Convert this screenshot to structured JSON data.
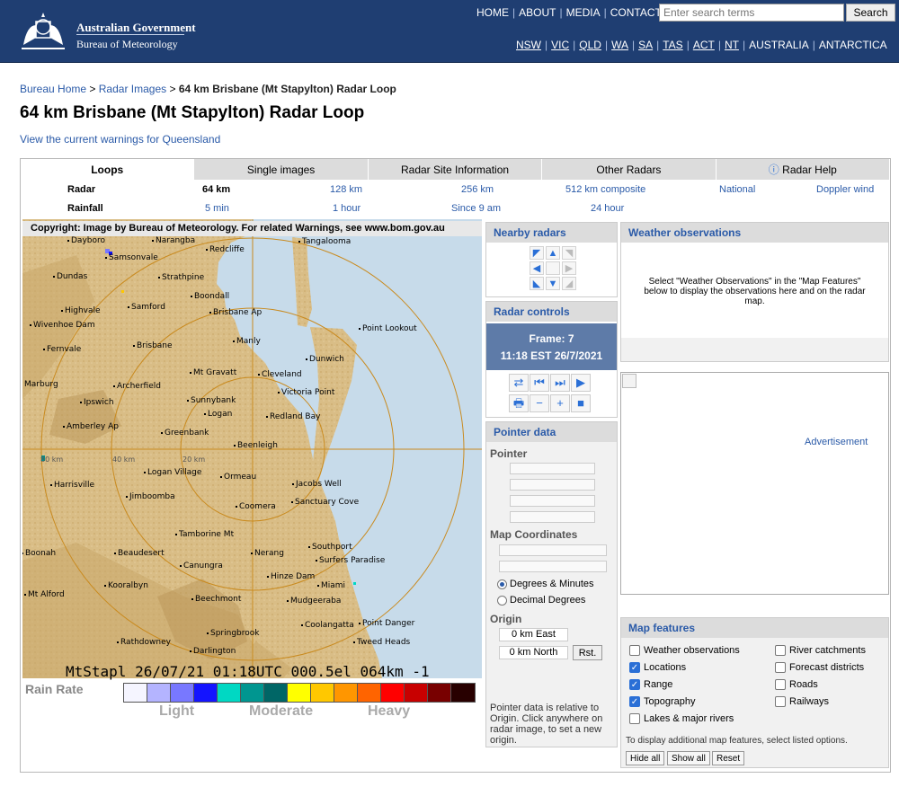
{
  "header": {
    "gov_name": "Australian Government",
    "agency_name": "Bureau of Meteorology",
    "top_links": [
      "HOME",
      "ABOUT",
      "MEDIA",
      "CONTACTS"
    ],
    "search_placeholder": "Enter search terms",
    "search_button": "Search",
    "state_links": [
      "NSW",
      "VIC",
      "QLD",
      "WA",
      "SA",
      "TAS",
      "ACT",
      "NT",
      "AUSTRALIA",
      "ANTARCTICA"
    ]
  },
  "breadcrumb": {
    "home": "Bureau Home",
    "sep": ">",
    "images": "Radar Images",
    "current": "64 km Brisbane (Mt Stapylton) Radar Loop"
  },
  "page_title": "64 km Brisbane (Mt Stapylton) Radar Loop",
  "warnings_link": "View the current warnings for Queensland",
  "tabs": [
    "Loops",
    "Single images",
    "Radar Site Information",
    "Other Radars",
    "Radar Help"
  ],
  "tab_help_icon": "info-icon",
  "radar_row": {
    "label": "Radar",
    "options": [
      "64 km",
      "128 km",
      "256 km",
      "512 km composite",
      "National",
      "Doppler wind"
    ]
  },
  "rain_row": {
    "label": "Rainfall",
    "options": [
      "5 min",
      "1 hour",
      "Since 9 am",
      "24 hour"
    ]
  },
  "radar_image": {
    "copyright": "Copyright: Image by Bureau of Meteorology. For related Warnings, see www.bom.gov.au",
    "caption": "MtStapl 26/07/21 01:18UTC 000.5el 064km -1",
    "range_labels": [
      "80 km",
      "40 km",
      "20 km"
    ],
    "places": [
      "Dayboro",
      "Narangba",
      "Redcliffe",
      "Tangalooma",
      "Samsonvale",
      "Dundas",
      "Strathpine",
      "Boondall",
      "Highvale",
      "Samford",
      "Brisbane Ap",
      "Wivenhoe Dam",
      "Manly",
      "Point Lookout",
      "Fernvale",
      "Brisbane",
      "Dunwich",
      "Mt Gravatt",
      "Cleveland",
      "Marburg",
      "Archerfield",
      "Victoria Point",
      "Ipswich",
      "Sunnybank",
      "Logan",
      "Redland Bay",
      "Amberley Ap",
      "Greenbank",
      "Beenleigh",
      "Logan Village",
      "Ormeau",
      "Jacobs Well",
      "Harrisville",
      "Jimboomba",
      "Coomera",
      "Sanctuary Cove",
      "Tamborine Mt",
      "Southport",
      "Boonah",
      "Beaudesert",
      "Nerang",
      "Surfers Paradise",
      "Canungra",
      "Hinze Dam",
      "Kooralbyn",
      "Miami",
      "Mt Alford",
      "Beechmont",
      "Mudgeeraba",
      "Coolangatta",
      "Point Danger",
      "Springbrook",
      "Tweed Heads",
      "Rathdowney",
      "Darlington"
    ]
  },
  "legend": {
    "title": "Rain Rate",
    "colors": [
      "#f5f5ff",
      "#b4b4ff",
      "#7878ff",
      "#1414ff",
      "#00d8c3",
      "#009690",
      "#006666",
      "#ffff00",
      "#ffc800",
      "#ff9600",
      "#ff6400",
      "#ff0000",
      "#c80000",
      "#780000",
      "#280000"
    ],
    "light": "Light",
    "moderate": "Moderate",
    "heavy": "Heavy"
  },
  "nearby": {
    "title": "Nearby radars",
    "buttons": [
      "arrow-nw-icon",
      "arrow-up-icon",
      "arrow-ne-icon",
      "arrow-left-icon",
      "center-icon",
      "arrow-right-icon",
      "arrow-sw-icon",
      "arrow-down-icon",
      "arrow-se-icon"
    ],
    "glyphs": [
      "◤",
      "▲",
      "◥",
      "◀",
      "",
      "▶",
      "◣",
      "▼",
      "◢"
    ],
    "enabled": [
      true,
      true,
      false,
      true,
      false,
      false,
      true,
      true,
      false
    ]
  },
  "controls": {
    "title": "Radar controls",
    "frame": "Frame: 7",
    "time": "11:18 EST 26/7/2021",
    "row1": [
      "⇄",
      "⏮",
      "⏭",
      "▶"
    ],
    "row1_names": [
      "swap-icon",
      "first-frame-icon",
      "last-frame-icon",
      "play-icon"
    ],
    "row2": [
      "🖶",
      "−",
      "+",
      "■"
    ],
    "row2_names": [
      "print-icon",
      "slower-icon",
      "faster-icon",
      "stop-icon"
    ]
  },
  "pointer": {
    "title": "Pointer data",
    "pointer_label": "Pointer",
    "map_coords_label": "Map Coordinates",
    "degrees_minutes": "Degrees & Minutes",
    "decimal_degrees": "Decimal Degrees",
    "origin_label": "Origin",
    "origin_east": "0 km East",
    "origin_north": "0 km North",
    "reset": "Rst.",
    "note": "Pointer data is relative to Origin. Click anywhere on radar image, to set a new origin."
  },
  "observations": {
    "title": "Weather observations",
    "message": "Select \"Weather Observations\" in the \"Map Features\" below to display the observations here and on the radar map."
  },
  "advertisement": "Advertisement",
  "map_features": {
    "title": "Map features",
    "left": [
      {
        "label": "Weather observations",
        "checked": false
      },
      {
        "label": "Locations",
        "checked": true
      },
      {
        "label": "Range",
        "checked": true
      },
      {
        "label": "Topography",
        "checked": true
      },
      {
        "label": "Lakes & major rivers",
        "checked": false
      }
    ],
    "right": [
      {
        "label": "River catchments",
        "checked": false
      },
      {
        "label": "Forecast districts",
        "checked": false
      },
      {
        "label": "Roads",
        "checked": false
      },
      {
        "label": "Railways",
        "checked": false
      }
    ],
    "note": "To display additional map features, select listed options.",
    "buttons": [
      "Hide all",
      "Show all",
      "Reset"
    ]
  }
}
